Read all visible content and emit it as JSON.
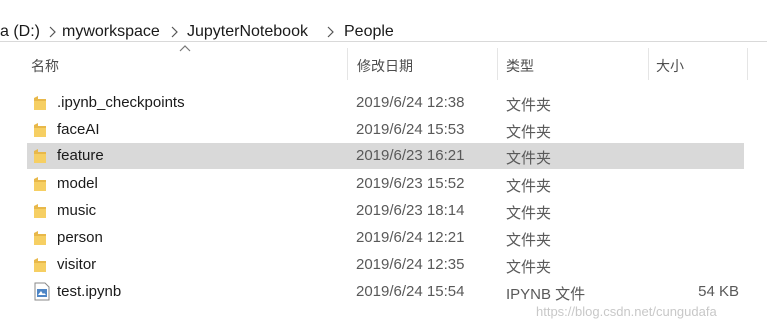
{
  "breadcrumb": {
    "drive": "a (D:)",
    "items": [
      "myworkspace",
      "JupyterNotebook",
      "People"
    ]
  },
  "columns": {
    "name": "名称",
    "modified": "修改日期",
    "type": "类型",
    "size": "大小"
  },
  "files": [
    {
      "name": ".ipynb_checkpoints",
      "modified": "2019/6/24 12:38",
      "type": "文件夹",
      "size": "",
      "icon": "folder-icon",
      "selected": false
    },
    {
      "name": "faceAI",
      "modified": "2019/6/24 15:53",
      "type": "文件夹",
      "size": "",
      "icon": "folder-icon",
      "selected": false
    },
    {
      "name": "feature",
      "modified": "2019/6/23 16:21",
      "type": "文件夹",
      "size": "",
      "icon": "folder-icon",
      "selected": true
    },
    {
      "name": "model",
      "modified": "2019/6/23 15:52",
      "type": "文件夹",
      "size": "",
      "icon": "folder-icon",
      "selected": false
    },
    {
      "name": "music",
      "modified": "2019/6/23 18:14",
      "type": "文件夹",
      "size": "",
      "icon": "folder-icon",
      "selected": false
    },
    {
      "name": "person",
      "modified": "2019/6/24 12:21",
      "type": "文件夹",
      "size": "",
      "icon": "folder-icon",
      "selected": false
    },
    {
      "name": "visitor",
      "modified": "2019/6/24 12:35",
      "type": "文件夹",
      "size": "",
      "icon": "folder-icon",
      "selected": false
    },
    {
      "name": "test.ipynb",
      "modified": "2019/6/24 15:54",
      "type": "IPYNB 文件",
      "size": "54 KB",
      "icon": "ipynb-file-icon",
      "selected": false
    }
  ],
  "watermark": "https://blog.csdn.net/cungudafa",
  "colors": {
    "selected_row": "#d9d9d9",
    "folder": "#e8b84a"
  }
}
